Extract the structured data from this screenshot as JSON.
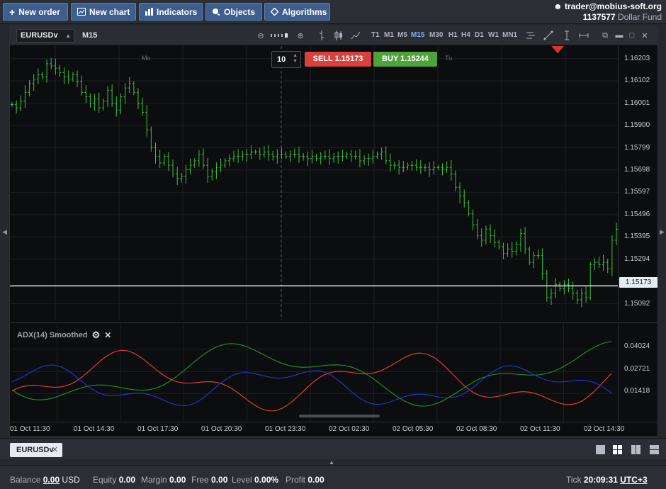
{
  "toolbar": {
    "new_order": "New order",
    "new_chart": "New chart",
    "indicators": "Indicators",
    "objects": "Objects",
    "algorithms": "Algorithms"
  },
  "account": {
    "user": "trader@mobius-soft.org",
    "number": "1137577",
    "fund": "Dollar Fund"
  },
  "chart": {
    "symbol": "EURUSDv",
    "timeframe": "M15",
    "timeframes": [
      "T1",
      "M1",
      "M5",
      "M15",
      "M30",
      "H1",
      "H4",
      "D1",
      "W1",
      "MN1"
    ],
    "active_timeframe": "M15",
    "quantity": "10",
    "sell_label": "SELL",
    "sell_price": "1.15173",
    "buy_label": "BUY",
    "buy_price": "1.15244",
    "day_labels": [
      "Mo",
      "Tu"
    ],
    "current_price_label": "1.15173",
    "colors": {
      "bull": "#3cc43c",
      "bear": "#3cc43c",
      "adx": "#1d8f1d",
      "plus_di": "#e03a35",
      "minus_di": "#2233cc"
    }
  },
  "indicator": {
    "title": "ADX(14) Smoothed",
    "ticks": [
      "0.04024",
      "0.02721",
      "0.01418"
    ]
  },
  "chart_data": {
    "type": "candlestick",
    "price_ticks": [
      "1.16203",
      "1.16102",
      "1.16001",
      "1.15900",
      "1.15799",
      "1.15698",
      "1.15597",
      "1.15496",
      "1.15395",
      "1.15294",
      "1.15092"
    ],
    "ylim": [
      1.1502,
      1.1626
    ],
    "time_labels": [
      "01 Oct 11:30",
      "01 Oct 14:30",
      "01 Oct 17:30",
      "01 Oct 20:30",
      "01 Oct 23:30",
      "02 Oct 02:30",
      "02 Oct 05:30",
      "02 Oct 08:30",
      "02 Oct 11:30",
      "02 Oct 14:30"
    ],
    "close": [
      1.15995,
      1.1598,
      1.1601,
      1.1605,
      1.1609,
      1.1611,
      1.1613,
      1.1612,
      1.1618,
      1.1617,
      1.1616,
      1.1614,
      1.1612,
      1.1611,
      1.1613,
      1.161,
      1.1605,
      1.1603,
      1.16,
      1.1602,
      1.1598,
      1.1601,
      1.1606,
      1.16,
      1.1597,
      1.1603,
      1.1607,
      1.1609,
      1.1605,
      1.16,
      1.1596,
      1.1588,
      1.158,
      1.1576,
      1.1573,
      1.1576,
      1.1572,
      1.1568,
      1.1566,
      1.1567,
      1.157,
      1.1572,
      1.1574,
      1.1577,
      1.1572,
      1.1567,
      1.1569,
      1.1571,
      1.1572,
      1.1574,
      1.1575,
      1.1576,
      1.1576,
      1.1577,
      1.1577,
      1.1578,
      1.1578,
      1.1577,
      1.1578,
      1.1577,
      1.1576,
      1.1577,
      1.1577,
      1.1576,
      1.1577,
      1.1577,
      1.1576,
      1.1576,
      1.1575,
      1.1576,
      1.1575,
      1.1576,
      1.1576,
      1.1575,
      1.1576,
      1.1576,
      1.1576,
      1.1577,
      1.1576,
      1.1576,
      1.1574,
      1.1575,
      1.1575,
      1.1576,
      1.1577,
      1.1578,
      1.1574,
      1.1572,
      1.1572,
      1.1571,
      1.1571,
      1.1572,
      1.1572,
      1.1571,
      1.1571,
      1.1571,
      1.157,
      1.1571,
      1.1571,
      1.157,
      1.1571,
      1.1568,
      1.1562,
      1.1558,
      1.1555,
      1.155,
      1.1545,
      1.154,
      1.1538,
      1.1543,
      1.154,
      1.1537,
      1.1535,
      1.1532,
      1.1534,
      1.1533,
      1.1536,
      1.1541,
      1.1534,
      1.1528,
      1.1531,
      1.1531,
      1.1523,
      1.1512,
      1.1514,
      1.1518,
      1.1516,
      1.1518,
      1.1516,
      1.1514,
      1.1511,
      1.1514,
      1.1512,
      1.1527,
      1.1528,
      1.1527,
      1.1528,
      1.1525,
      1.1538,
      1.1543
    ]
  },
  "tabs": {
    "active": "EURUSDv"
  },
  "status": {
    "balance_label": "Balance",
    "balance_value": "0.00",
    "balance_currency": "USD",
    "equity_label": "Equity",
    "equity_value": "0.00",
    "margin_label": "Margin",
    "margin_value": "0.00",
    "free_label": "Free",
    "free_value": "0.00",
    "level_label": "Level",
    "level_value": "0.00%",
    "profit_label": "Profit",
    "profit_value": "0.00",
    "tick_label": "Tick",
    "tick_time": "20:09:31",
    "timezone": "UTC+3"
  }
}
